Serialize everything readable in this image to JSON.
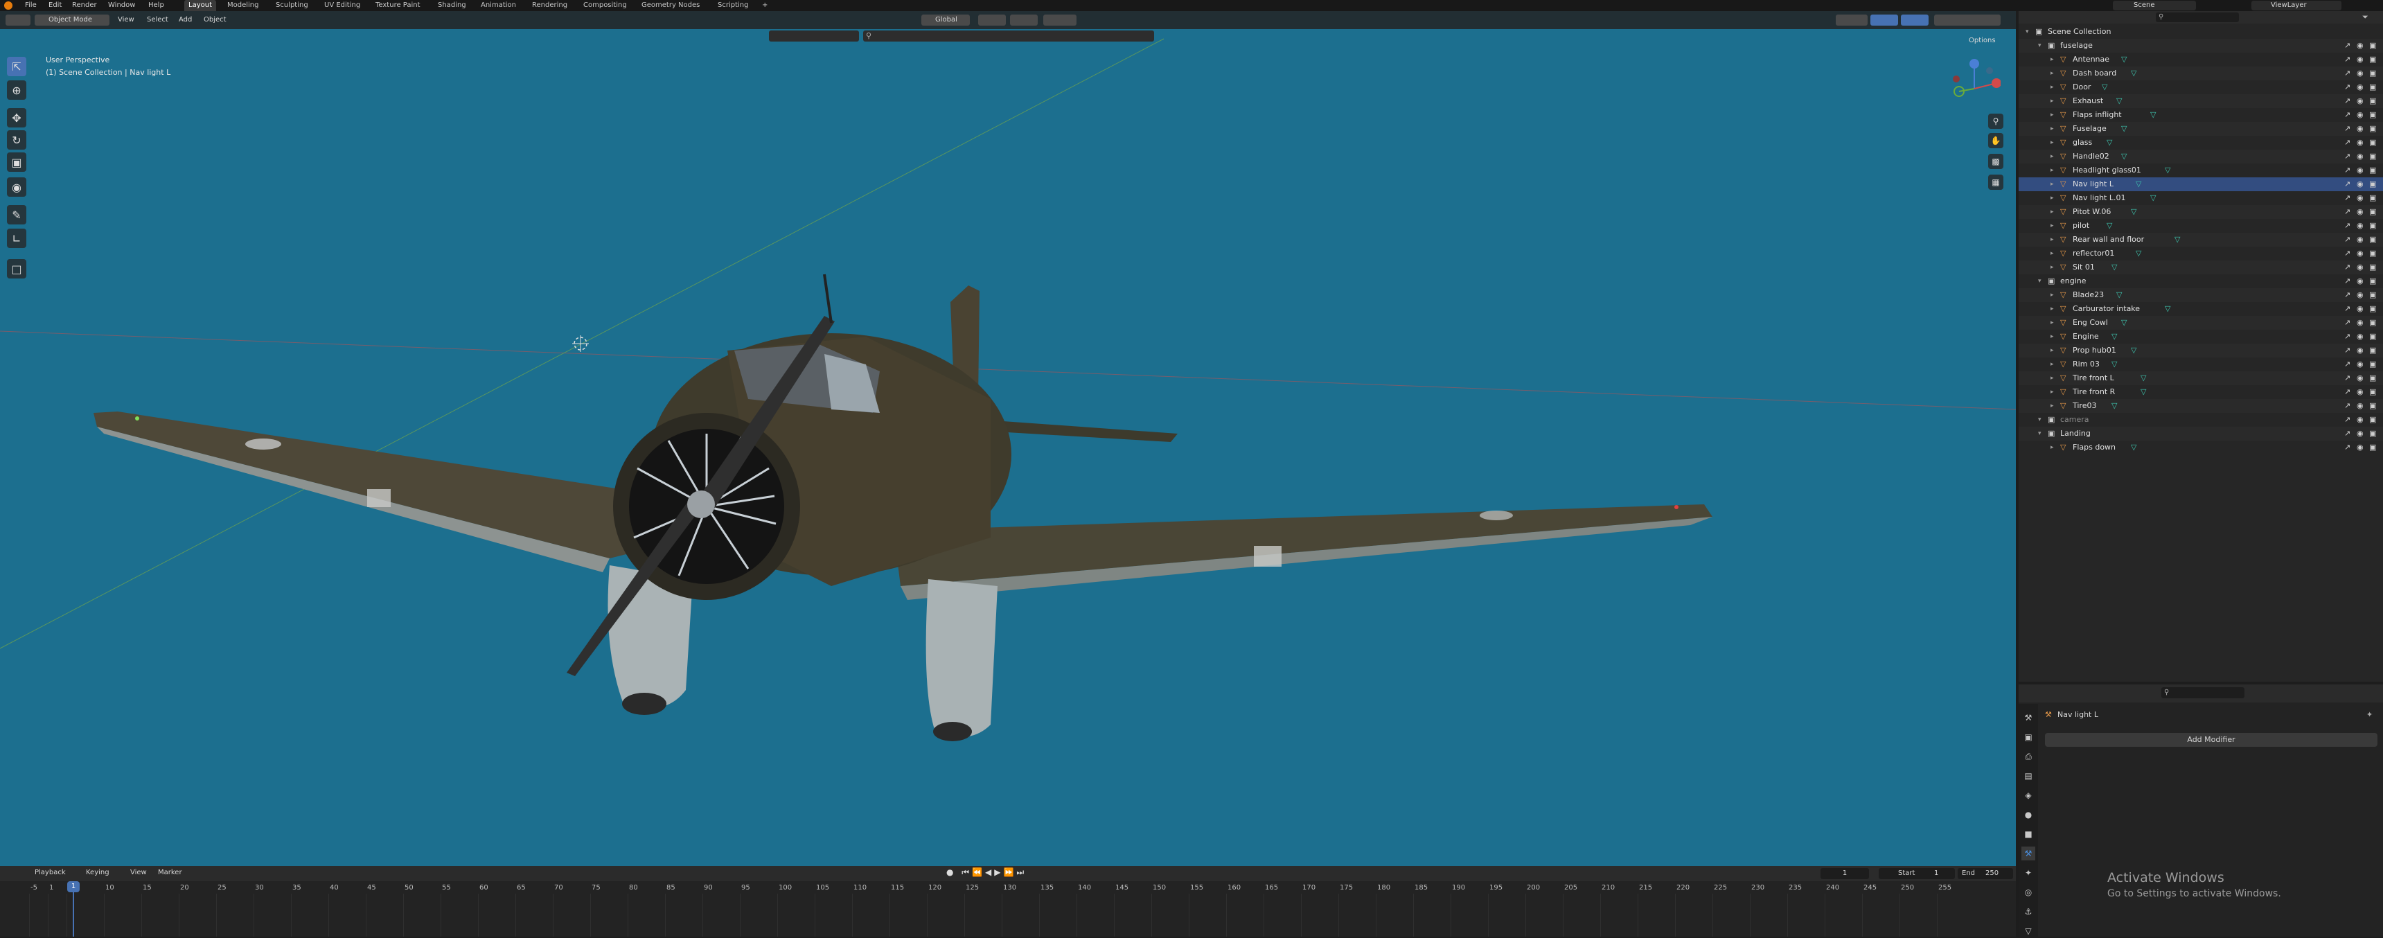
{
  "menubar": {
    "menus": [
      "File",
      "Edit",
      "Render",
      "Window",
      "Help"
    ],
    "workspaces": [
      "Layout",
      "Modeling",
      "Sculpting",
      "UV Editing",
      "Texture Paint",
      "Shading",
      "Animation",
      "Rendering",
      "Compositing",
      "Geometry Nodes",
      "Scripting",
      "+"
    ],
    "scene": "Scene",
    "viewlayer": "ViewLayer"
  },
  "viewport_header": {
    "mode": "Object Mode",
    "menus": [
      "View",
      "Select",
      "Add",
      "Object"
    ],
    "orientation": "Global",
    "options": "Options"
  },
  "viewport_overlay": {
    "line1": "User Perspective",
    "line2": "(1) Scene Collection | Nav light L"
  },
  "outliner": {
    "root": "Scene Collection",
    "fuselage_label": "fuselage",
    "fuselage": [
      "Antennae",
      "Dash board",
      "Door",
      "Exhaust",
      "Flaps inflight",
      "Fuselage",
      "glass",
      "Handle02",
      "Headlight glass01",
      "Nav light L",
      "Nav light L.01",
      "Pitot W.06",
      "pilot",
      "Rear wall and floor",
      "reflector01",
      "Sit 01"
    ],
    "engine_label": "engine",
    "engine": [
      "Blade23",
      "Carburator intake",
      "Eng Cowl",
      "Engine",
      "Prop hub01",
      "Rim 03",
      "Tire front L",
      "Tire front R",
      "Tire03"
    ],
    "camera_label": "camera",
    "landing_label": "Landing",
    "landing": [
      "Flaps down"
    ],
    "selected": "Nav light L"
  },
  "properties": {
    "object_name": "Nav light L",
    "add_modifier": "Add Modifier"
  },
  "timeline": {
    "menus": [
      "Playback",
      "Keying",
      "View",
      "Marker"
    ],
    "current_frame": "1",
    "start_label": "Start",
    "start": "1",
    "end_label": "End",
    "end": "250",
    "ticks": [
      "-5",
      "1",
      "5",
      "10",
      "15",
      "20",
      "25",
      "30",
      "35",
      "40",
      "45",
      "50",
      "55",
      "60",
      "65",
      "70",
      "75",
      "80",
      "85",
      "90",
      "95",
      "100",
      "105",
      "110",
      "115",
      "120",
      "125",
      "130",
      "135",
      "140",
      "145",
      "150",
      "155",
      "160",
      "165",
      "170",
      "175",
      "180",
      "185",
      "190",
      "195",
      "200",
      "205",
      "210",
      "215",
      "220",
      "225",
      "230",
      "235",
      "240",
      "245",
      "250",
      "255"
    ]
  },
  "watermark": {
    "title": "Activate Windows",
    "subtitle": "Go to Settings to activate Windows."
  }
}
